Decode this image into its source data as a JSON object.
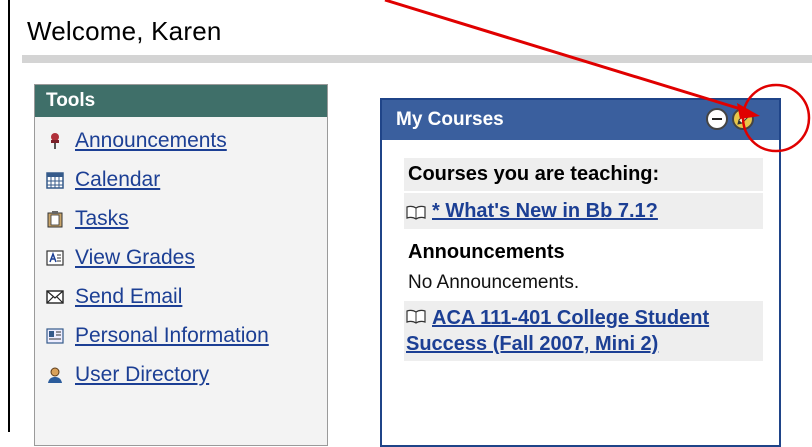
{
  "header": {
    "welcome": "Welcome, Karen"
  },
  "tools": {
    "title": "Tools",
    "items": [
      {
        "label": "Announcements",
        "icon": "pushpin-icon"
      },
      {
        "label": "Calendar",
        "icon": "calendar-icon"
      },
      {
        "label": "Tasks",
        "icon": "clipboard-icon"
      },
      {
        "label": "View Grades",
        "icon": "grades-icon"
      },
      {
        "label": "Send Email",
        "icon": "envelope-icon"
      },
      {
        "label": "Personal Information",
        "icon": "id-card-icon"
      },
      {
        "label": "User Directory",
        "icon": "user-icon"
      }
    ]
  },
  "courses": {
    "title": "My Courses",
    "teaching_label": "Courses you are teaching:",
    "course_1": "* What's New in Bb 7.1?",
    "announcements_label": "Announcements",
    "no_announcements": "No Announcements.",
    "course_2": "ACA 111-401 College Student Success (Fall 2007, Mini 2)"
  },
  "annotation": {
    "color": "#e00000"
  }
}
